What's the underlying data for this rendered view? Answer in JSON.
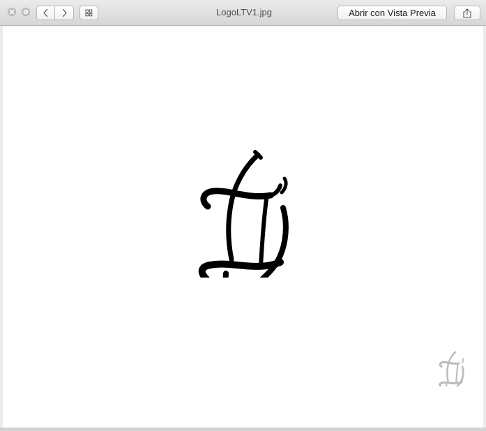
{
  "window": {
    "title": "LogoLTV1.jpg",
    "open_with_button": "Abrir con Vista Previa"
  },
  "toolbar": {
    "close_icon": "close-icon",
    "fullscreen_icon": "fullscreen-icon",
    "back_icon": "chevron-left-icon",
    "forward_icon": "chevron-right-icon",
    "index_sheet_icon": "grid-icon",
    "share_icon": "share-icon"
  },
  "content": {
    "image_subject": "calligraphic-monogram-logo",
    "watermark": "calligraphic-monogram-logo",
    "logo_color": "#000000",
    "watermark_color": "#bdbdbd",
    "background": "#ffffff"
  }
}
